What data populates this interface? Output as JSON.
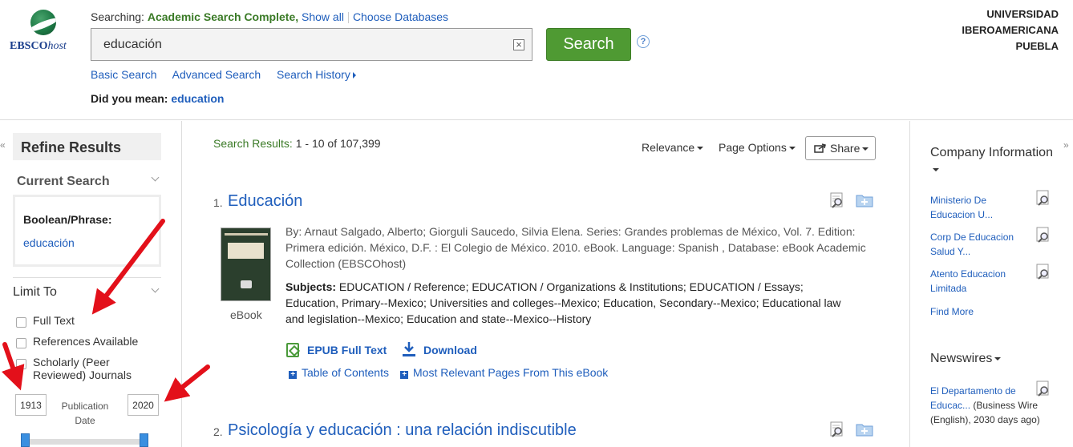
{
  "brand": {
    "logo_main": "EBSCO",
    "logo_suffix": "host"
  },
  "header": {
    "searching_label": "Searching:",
    "database": "Academic Search Complete,",
    "show_all": "Show all",
    "choose_databases": "Choose Databases",
    "query": "educación",
    "search_button": "Search",
    "help": "?",
    "clear": "×",
    "nav": {
      "basic": "Basic Search",
      "advanced": "Advanced Search",
      "history": "Search History"
    },
    "did_you_mean_label": "Did you mean:",
    "did_you_mean_value": "education",
    "institution": [
      "UNIVERSIDAD",
      "IBEROAMERICANA",
      "PUEBLA"
    ]
  },
  "left": {
    "collapse": "«",
    "refine_title": "Refine Results",
    "current_search": "Current Search",
    "boolean_label": "Boolean/Phrase:",
    "boolean_value": "educación",
    "limit_to": "Limit To",
    "limits": [
      "Full Text",
      "References Available",
      "Scholarly (Peer Reviewed) Journals"
    ],
    "year_from": "1913",
    "year_to": "2020",
    "pub_date": "Publication Date"
  },
  "center": {
    "results_label": "Search Results:",
    "results_range": "1 - 10 of 107,399",
    "relevance": "Relevance",
    "page_options": "Page Options",
    "share": "Share",
    "results": [
      {
        "num": "1.",
        "title": "Educación",
        "meta": "By: Arnaut Salgado, Alberto; Giorguli Saucedo, Silvia Elena. Series: Grandes problemas de México, Vol. 7. Edition: Primera edición. México, D.F. : El Colegio de México. 2010. eBook. Language: Spanish , Database: eBook Academic Collection (EBSCOhost)",
        "subjects_label": "Subjects:",
        "subjects": "EDUCATION / Reference; EDUCATION / Organizations & Institutions; EDUCATION / Essays; Education, Primary--Mexico; Universities and colleges--Mexico; Education, Secondary--Mexico; Educational law and legislation--Mexico; Education and state--Mexico--History",
        "type": "eBook",
        "epub": "EPUB Full Text",
        "download": "Download",
        "toc": "Table of Contents",
        "mrp": "Most Relevant Pages From This eBook"
      },
      {
        "num": "2.",
        "title": "Psicología y educación : una relación indiscutible"
      }
    ]
  },
  "right": {
    "collapse": "»",
    "company_title": "Company Information",
    "companies": [
      "Ministerio De Educacion U...",
      "Corp De Educacion Salud Y...",
      "Atento Educacion Limitada"
    ],
    "find_more": "Find More",
    "newswires_title": "Newswires",
    "newswire_link": "El Departamento de Educac...",
    "newswire_meta": " (Business Wire (English), 2030 days ago)"
  },
  "colors": {
    "accent_green": "#4f9a33",
    "link_blue": "#1f5ebc",
    "arrow_red": "#e3101a"
  }
}
